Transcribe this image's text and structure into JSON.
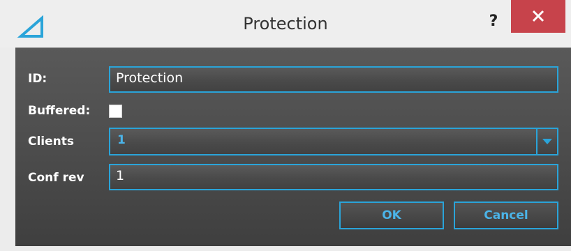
{
  "window": {
    "title": "Protection",
    "help_label": "?",
    "close_icon": "close-icon",
    "logo_icon": "app-logo-icon",
    "accent_color": "#2aa4d9",
    "close_color": "#c7434b"
  },
  "form": {
    "id": {
      "label": "ID:",
      "value": "Protection"
    },
    "buffered": {
      "label": "Buffered:",
      "checked": false
    },
    "clients": {
      "label": "Clients",
      "selected": "1"
    },
    "conf_rev": {
      "label": "Conf rev",
      "value": "1"
    }
  },
  "buttons": {
    "ok_label": "OK",
    "cancel_label": "Cancel"
  }
}
